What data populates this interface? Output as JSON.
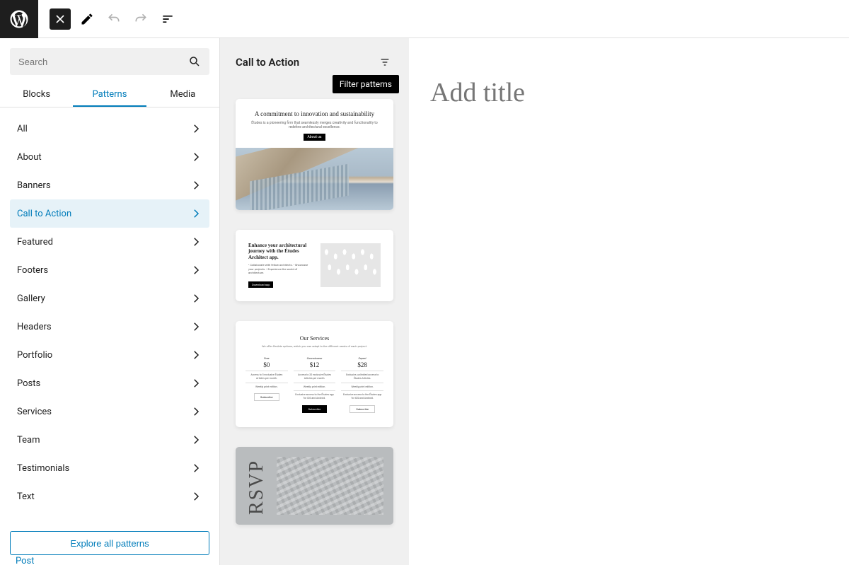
{
  "toolbar": {
    "wp_logo": "WordPress"
  },
  "search": {
    "placeholder": "Search"
  },
  "tabs": [
    {
      "label": "Blocks",
      "active": false
    },
    {
      "label": "Patterns",
      "active": true
    },
    {
      "label": "Media",
      "active": false
    }
  ],
  "categories": [
    {
      "label": "All",
      "selected": false
    },
    {
      "label": "About",
      "selected": false
    },
    {
      "label": "Banners",
      "selected": false
    },
    {
      "label": "Call to Action",
      "selected": true
    },
    {
      "label": "Featured",
      "selected": false
    },
    {
      "label": "Footers",
      "selected": false
    },
    {
      "label": "Gallery",
      "selected": false
    },
    {
      "label": "Headers",
      "selected": false
    },
    {
      "label": "Portfolio",
      "selected": false
    },
    {
      "label": "Posts",
      "selected": false
    },
    {
      "label": "Services",
      "selected": false
    },
    {
      "label": "Team",
      "selected": false
    },
    {
      "label": "Testimonials",
      "selected": false
    },
    {
      "label": "Text",
      "selected": false
    }
  ],
  "explore_label": "Explore all patterns",
  "post_link": "Post",
  "mid": {
    "title": "Call to Action",
    "filter_tooltip": "Filter patterns"
  },
  "patterns": {
    "p1": {
      "title": "A commitment to innovation and sustainability",
      "sub": "Études is a pioneering firm that seamlessly merges creativity and functionality to redefine architectural excellence.",
      "btn": "About us"
    },
    "p2": {
      "title": "Enhance your architectural journey with the Études Architect app.",
      "bullets": "• Collaborate with fellow architects.\n• Showcase your projects.\n• Experience the world of architecture.",
      "btn": "Download app"
    },
    "p3": {
      "title": "Our Services",
      "sub": "We offer flexible options, which you can adapt to the different needs of each project.",
      "cols": [
        {
          "plan": "Free",
          "price": "$0",
          "l1": "Access to 5 exclusive Études Articles per month.",
          "l2": "Weekly print edition.",
          "l3": "",
          "cta": "Subscribe",
          "dark": false
        },
        {
          "plan": "Connoisseur",
          "price": "$12",
          "l1": "Access to 20 exclusive Études Articles per month.",
          "l2": "Weekly print edition.",
          "l3": "Exclusive access to the Études app for iOS and Android.",
          "cta": "Subscribe",
          "dark": true
        },
        {
          "plan": "Expert",
          "price": "$28",
          "l1": "Exclusive, unlimited access to Études Articles.",
          "l2": "Weekly print edition.",
          "l3": "Exclusive access to the Études app for iOS and Android.",
          "cta": "Subscribe",
          "dark": false
        }
      ]
    },
    "p4": {
      "text": "RSVP"
    }
  },
  "canvas": {
    "title_placeholder": "Add title"
  }
}
